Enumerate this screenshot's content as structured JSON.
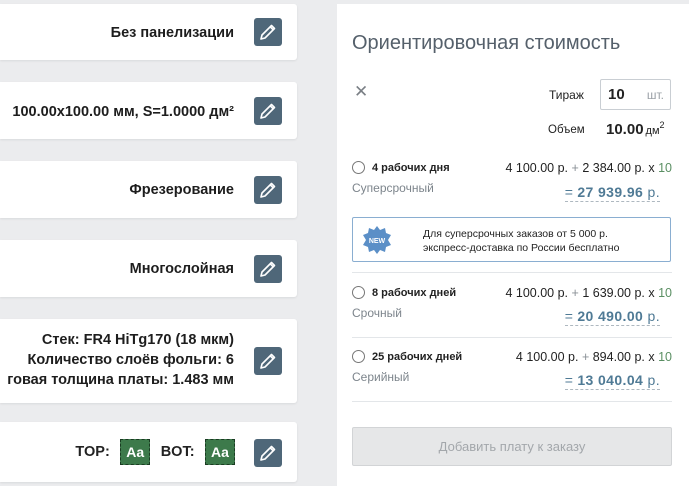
{
  "left_cards": {
    "panelization": "Без панелизации",
    "size": "100.00x100.00 мм, S=1.0000 дм²",
    "milling": "Фрезерование",
    "layers": "Многослойная",
    "stack_line1": "Стек: FR4 HiTg170 (18 мкм)",
    "stack_line2": "Количество слоёв фольги: 6",
    "stack_line3": "говая толщина платы: 1.483 мм",
    "mask_top_label": "TOP:",
    "mask_bot_label": "BOT:",
    "mask_top_swatch": "Aa",
    "mask_bot_swatch": "Aa"
  },
  "panel": {
    "title": "Ориентировочная стоимость",
    "close_symbol": "✕",
    "quantity_label": "Тираж",
    "quantity_value": "10",
    "quantity_unit": "шт.",
    "volume_label": "Объем",
    "volume_value": "10.00",
    "volume_unit": "дм",
    "volume_exp": "2",
    "options": [
      {
        "days": "4 рабочих дня",
        "category": "Суперсрочный",
        "base": "4 100.00 р.",
        "plus": "+",
        "per_unit": "2 384.00 р.",
        "times": "x",
        "qty": "10",
        "eq": "=",
        "total": "27 939.96",
        "currency": "р."
      },
      {
        "days": "8 рабочих дней",
        "category": "Срочный",
        "base": "4 100.00 р.",
        "plus": "+",
        "per_unit": "1 639.00 р.",
        "times": "x",
        "qty": "10",
        "eq": "=",
        "total": "20 490.00",
        "currency": "р."
      },
      {
        "days": "25 рабочих дней",
        "category": "Серийный",
        "base": "4 100.00 р.",
        "plus": "+",
        "per_unit": "894.00 р.",
        "times": "x",
        "qty": "10",
        "eq": "=",
        "total": "13 040.04",
        "currency": "р."
      }
    ],
    "promo_badge": "NEW",
    "promo_line1": "Для суперсрочных заказов от 5 000 р.",
    "promo_line2": "экспресс-доставка по России бесплатно",
    "add_button": "Добавить плату к заказу"
  },
  "colors": {
    "edit_button": "#4f6779",
    "total_text": "#4f7a95",
    "quantity_accent": "#5a8f63",
    "promo_border": "#8aaed1",
    "mask_green": "#3d7a4b"
  },
  "icons": {
    "edit": "pencil-icon",
    "close": "close-icon",
    "promo": "new-badge-icon"
  }
}
